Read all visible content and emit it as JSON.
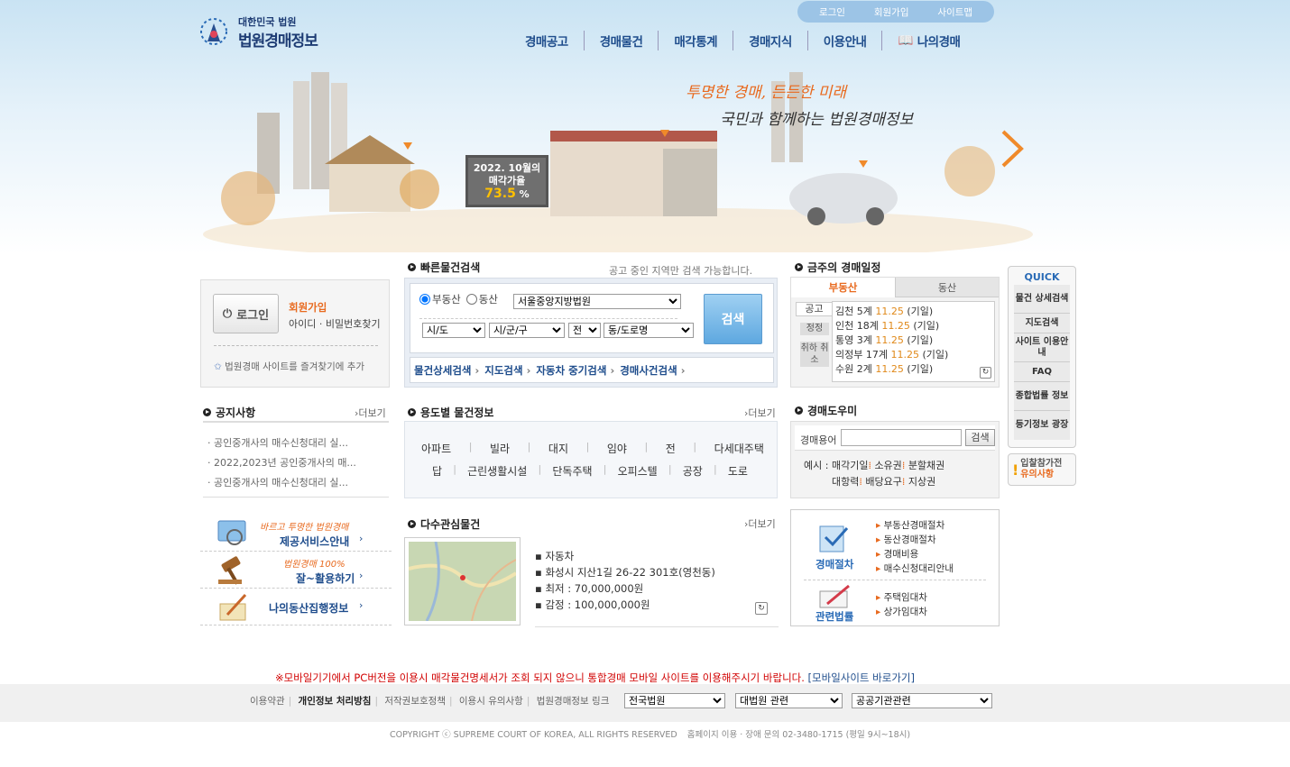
{
  "logo": {
    "sub": "대한민국 법원",
    "title": "법원경매정보"
  },
  "util": [
    "로그인",
    "회원가입",
    "사이트맵"
  ],
  "gnb": [
    "경매공고",
    "경매물건",
    "매각통계",
    "경매지식",
    "이용안내",
    "나의경매"
  ],
  "slogan": {
    "line1": "투명한 경매, 든든한 미래",
    "line2": "국민과 함께하는 법원경매정보"
  },
  "billboard": {
    "line1": "2022. 10월의",
    "line2": "매각가율",
    "rate": "73.5",
    "unit": "%"
  },
  "login": {
    "button": "로그인",
    "join": "회원가입",
    "find": "아이디 · 비밀번호찾기",
    "favorite": "법원경매 사이트를 즐겨찾기에 추가"
  },
  "quick_search": {
    "title": "빠른물건검색",
    "note": "공고 중인 지역만 검색 가능합니다.",
    "radio1": "부동산",
    "radio2": "동산",
    "court": "서울중앙지방법원",
    "sido": "시/도",
    "sigungu": "시/군/구",
    "jeon": "전",
    "dong": "동/도로명",
    "search": "검색",
    "links": [
      "물건상세검색",
      "지도검색",
      "자동차 중기검색",
      "경매사건검색"
    ]
  },
  "schedule": {
    "title": "금주의 경매일정",
    "tab1": "부동산",
    "tab2": "동산",
    "side": [
      "공고",
      "정정",
      "취하 취소"
    ],
    "rows": [
      {
        "court": "김천 5계",
        "date": "11.25",
        "day": "(기일)"
      },
      {
        "court": "인천 18계",
        "date": "11.25",
        "day": "(기일)"
      },
      {
        "court": "통영 3계",
        "date": "11.25",
        "day": "(기일)"
      },
      {
        "court": "의정부 17계",
        "date": "11.25",
        "day": "(기일)"
      },
      {
        "court": "수원 2계",
        "date": "11.25",
        "day": "(기일)"
      }
    ]
  },
  "quick": {
    "title": "QUICK",
    "items": [
      "물건 상세검색",
      "지도검색",
      "사이트 이용안내",
      "FAQ",
      "종합법률 정보",
      "등기정보 광장"
    ]
  },
  "caution": {
    "line1": "입찰참가전",
    "line2": "유의사항"
  },
  "notice": {
    "title": "공지사항",
    "more": "더보기",
    "items": [
      "공인중개사의 매수신청대리 실...",
      "2022,2023년 공인중개사의 매...",
      "공인중개사의 매수신청대리 실..."
    ]
  },
  "usage": {
    "title": "용도별 물건정보",
    "more": "더보기",
    "row1": [
      "아파트",
      "빌라",
      "대지",
      "임야",
      "전",
      "다세대주택"
    ],
    "row2": [
      "답",
      "근린생활시설",
      "단독주택",
      "오피스텔",
      "공장",
      "도로"
    ]
  },
  "help": {
    "title": "경매도우미",
    "label": "경매용어",
    "search": "검색",
    "example": "예시 :",
    "terms1": [
      "매각기일",
      "소유권",
      "분할채권"
    ],
    "terms2": [
      "대항력",
      "배당요구",
      "지상권"
    ]
  },
  "banners": [
    {
      "tag": "바르고 투명한 법원경매",
      "title": "제공서비스안내"
    },
    {
      "tag": "법원경매 100%",
      "title": "잘~활용하기"
    },
    {
      "tag": "",
      "title": "나의동산집행정보"
    }
  ],
  "interest": {
    "title": "다수관심물건",
    "more": "더보기",
    "type": "자동차",
    "addr": "화성시 지산1길 26-22 301호(영천동)",
    "min": "최저 : 70,000,000원",
    "appraisal": "감정 : 100,000,000원"
  },
  "procedure": {
    "label1": "경매절차",
    "items1": [
      "부동산경매절차",
      "동산경매절차",
      "경매비용",
      "매수신청대리안내"
    ],
    "label2": "관련법률",
    "items2": [
      "주택임대차",
      "상가임대차"
    ]
  },
  "mobile_notice": "※모바일기기에서 PC버전을 이용시 매각물건명세서가 조회 되지 않으니 통합경매 모바일 사이트를 이용해주시기 바랍니다.",
  "mobile_link": "[모바일사이트 바로가기]",
  "footer": {
    "links": [
      "이용약관",
      "개인정보 처리방침",
      "저작권보호정책",
      "이용시 유의사항",
      "법원경매정보 링크"
    ],
    "sel1": "전국법원",
    "sel2": "대법원 관련",
    "sel3": "공공기관관련",
    "copyright": "COPYRIGHT ⓒ  SUPREME COURT OF KOREA, ALL RIGHTS RESERVED",
    "contact": "홈페이지 이용 · 장애 문의 02-3480-1715 (평일 9시~18시)"
  },
  "colors": {
    "nav": "#1f4d8c",
    "accent": "#e86a1f",
    "quick_btn": "#7ab9e8"
  }
}
